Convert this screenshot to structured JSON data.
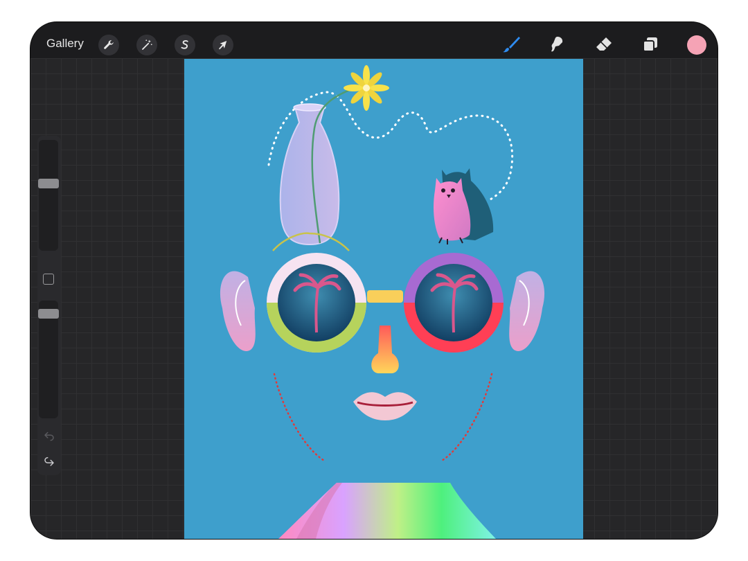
{
  "topbar": {
    "gallery_label": "Gallery",
    "left_tools": [
      {
        "name": "actions",
        "icon": "wrench-icon"
      },
      {
        "name": "adjustments",
        "icon": "magic-wand-icon"
      },
      {
        "name": "selection",
        "icon": "selection-s-icon"
      },
      {
        "name": "transform",
        "icon": "arrow-cursor-icon"
      }
    ],
    "right_tools": [
      {
        "name": "brush",
        "icon": "brush-icon",
        "active": true
      },
      {
        "name": "smudge",
        "icon": "smudge-icon",
        "active": false
      },
      {
        "name": "eraser",
        "icon": "eraser-icon",
        "active": false
      },
      {
        "name": "layers",
        "icon": "layers-icon",
        "active": false
      }
    ],
    "current_color": "#f5a3b5",
    "accent_color": "#2f8cf0"
  },
  "sidebar": {
    "brush_size_icon": "brush-size-slider",
    "modify_icon": "square-modify-icon",
    "opacity_icon": "opacity-slider",
    "undo_icon": "undo-arrow-icon",
    "redo_icon": "redo-arrow-icon"
  },
  "canvas": {
    "background_color": "#3e9fcc",
    "artwork": "illustration-face-with-sunglasses"
  }
}
